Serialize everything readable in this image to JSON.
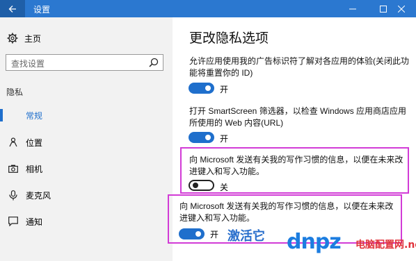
{
  "window": {
    "title": "设置",
    "back_icon": "back-arrow-icon",
    "controls": [
      "minimize-icon",
      "maximize-icon",
      "close-icon"
    ]
  },
  "sidebar": {
    "home_label": "主页",
    "search_placeholder": "查找设置",
    "section_label": "隐私",
    "items": [
      {
        "label": "常规",
        "icon": "lock-icon",
        "active": true
      },
      {
        "label": "位置",
        "icon": "location-person-icon",
        "active": false
      },
      {
        "label": "相机",
        "icon": "camera-icon",
        "active": false
      },
      {
        "label": "麦克风",
        "icon": "microphone-icon",
        "active": false
      },
      {
        "label": "通知",
        "icon": "notification-icon",
        "active": false
      }
    ]
  },
  "main": {
    "title": "更改隐私选项",
    "settings": [
      {
        "description": "允许应用使用我的广告标识符了解对各应用的体验(关闭此功能将重置你的 ID)",
        "state": "开"
      },
      {
        "description": "打开 SmartScreen 筛选器，以检查 Windows 应用商店应用所使用的 Web 内容(URL)",
        "state": "开"
      },
      {
        "description": "向 Microsoft 发送有关我的写作习惯的信息，以便在未来改进键入和写入功能。",
        "state": "关"
      },
      {
        "description": "向 Microsoft 发送有关我的写作习惯的信息，以便在未来改进键入和写入功能。",
        "state": "开"
      }
    ],
    "annotation": "激活它"
  },
  "watermark": {
    "logo_text": "dnpz",
    "badge_text": "电脑配置网",
    "domain": ".net"
  },
  "colors": {
    "titlebar": "#2b78d0",
    "accent": "#1f6fcc",
    "highlight": "#d23bd6"
  }
}
